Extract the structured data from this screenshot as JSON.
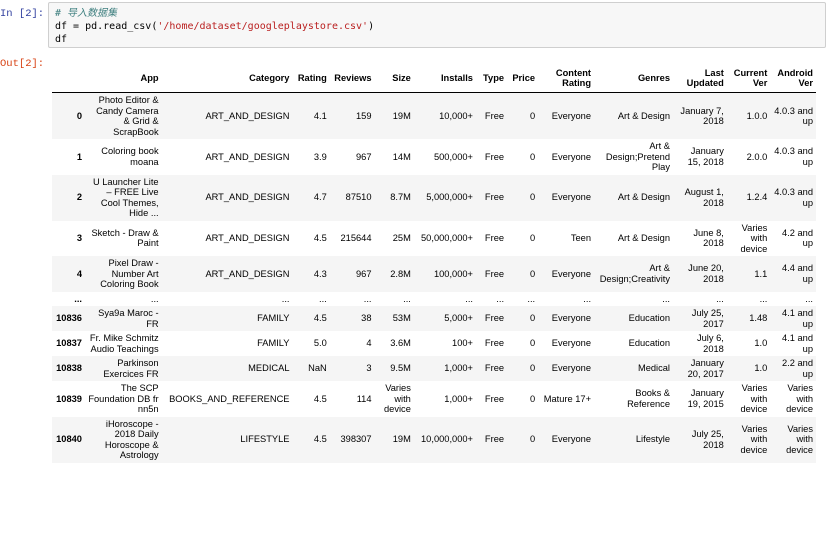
{
  "notebook": {
    "in_prompt": "In  [2]:",
    "out_prompt": "Out[2]:",
    "code": {
      "comment": "# 导入数据集",
      "line2_pre": "df = pd.read_csv(",
      "line2_str": "'/home/dataset/googleplaystore.csv'",
      "line2_post": ")",
      "line3": "df"
    }
  },
  "table": {
    "columns": [
      "",
      "App",
      "Category",
      "Rating",
      "Reviews",
      "Size",
      "Installs",
      "Type",
      "Price",
      "Content Rating",
      "Genres",
      "Last Updated",
      "Current Ver",
      "Android Ver"
    ],
    "rows": [
      {
        "index": "0",
        "cells": [
          "Photo Editor & Candy Camera & Grid & ScrapBook",
          "ART_AND_DESIGN",
          "4.1",
          "159",
          "19M",
          "10,000+",
          "Free",
          "0",
          "Everyone",
          "Art & Design",
          "January 7, 2018",
          "1.0.0",
          "4.0.3 and up"
        ]
      },
      {
        "index": "1",
        "cells": [
          "Coloring book moana",
          "ART_AND_DESIGN",
          "3.9",
          "967",
          "14M",
          "500,000+",
          "Free",
          "0",
          "Everyone",
          "Art & Design;Pretend Play",
          "January 15, 2018",
          "2.0.0",
          "4.0.3 and up"
        ]
      },
      {
        "index": "2",
        "cells": [
          "U Launcher Lite – FREE Live Cool Themes, Hide ...",
          "ART_AND_DESIGN",
          "4.7",
          "87510",
          "8.7M",
          "5,000,000+",
          "Free",
          "0",
          "Everyone",
          "Art & Design",
          "August 1, 2018",
          "1.2.4",
          "4.0.3 and up"
        ]
      },
      {
        "index": "3",
        "cells": [
          "Sketch - Draw & Paint",
          "ART_AND_DESIGN",
          "4.5",
          "215644",
          "25M",
          "50,000,000+",
          "Free",
          "0",
          "Teen",
          "Art & Design",
          "June 8, 2018",
          "Varies with device",
          "4.2 and up"
        ]
      },
      {
        "index": "4",
        "cells": [
          "Pixel Draw - Number Art Coloring Book",
          "ART_AND_DESIGN",
          "4.3",
          "967",
          "2.8M",
          "100,000+",
          "Free",
          "0",
          "Everyone",
          "Art & Design;Creativity",
          "June 20, 2018",
          "1.1",
          "4.4 and up"
        ]
      },
      {
        "index": "...",
        "cells": [
          "...",
          "...",
          "...",
          "...",
          "...",
          "...",
          "...",
          "...",
          "...",
          "...",
          "...",
          "...",
          "..."
        ]
      },
      {
        "index": "10836",
        "cells": [
          "Sya9a Maroc - FR",
          "FAMILY",
          "4.5",
          "38",
          "53M",
          "5,000+",
          "Free",
          "0",
          "Everyone",
          "Education",
          "July 25, 2017",
          "1.48",
          "4.1 and up"
        ]
      },
      {
        "index": "10837",
        "cells": [
          "Fr. Mike Schmitz Audio Teachings",
          "FAMILY",
          "5.0",
          "4",
          "3.6M",
          "100+",
          "Free",
          "0",
          "Everyone",
          "Education",
          "July 6, 2018",
          "1.0",
          "4.1 and up"
        ]
      },
      {
        "index": "10838",
        "cells": [
          "Parkinson Exercices FR",
          "MEDICAL",
          "NaN",
          "3",
          "9.5M",
          "1,000+",
          "Free",
          "0",
          "Everyone",
          "Medical",
          "January 20, 2017",
          "1.0",
          "2.2 and up"
        ]
      },
      {
        "index": "10839",
        "cells": [
          "The SCP Foundation DB fr nn5n",
          "BOOKS_AND_REFERENCE",
          "4.5",
          "114",
          "Varies with device",
          "1,000+",
          "Free",
          "0",
          "Mature 17+",
          "Books & Reference",
          "January 19, 2015",
          "Varies with device",
          "Varies with device"
        ]
      },
      {
        "index": "10840",
        "cells": [
          "iHoroscope - 2018 Daily Horoscope & Astrology",
          "LIFESTYLE",
          "4.5",
          "398307",
          "19M",
          "10,000,000+",
          "Free",
          "0",
          "Everyone",
          "Lifestyle",
          "July 25, 2018",
          "Varies with device",
          "Varies with device"
        ]
      }
    ]
  }
}
